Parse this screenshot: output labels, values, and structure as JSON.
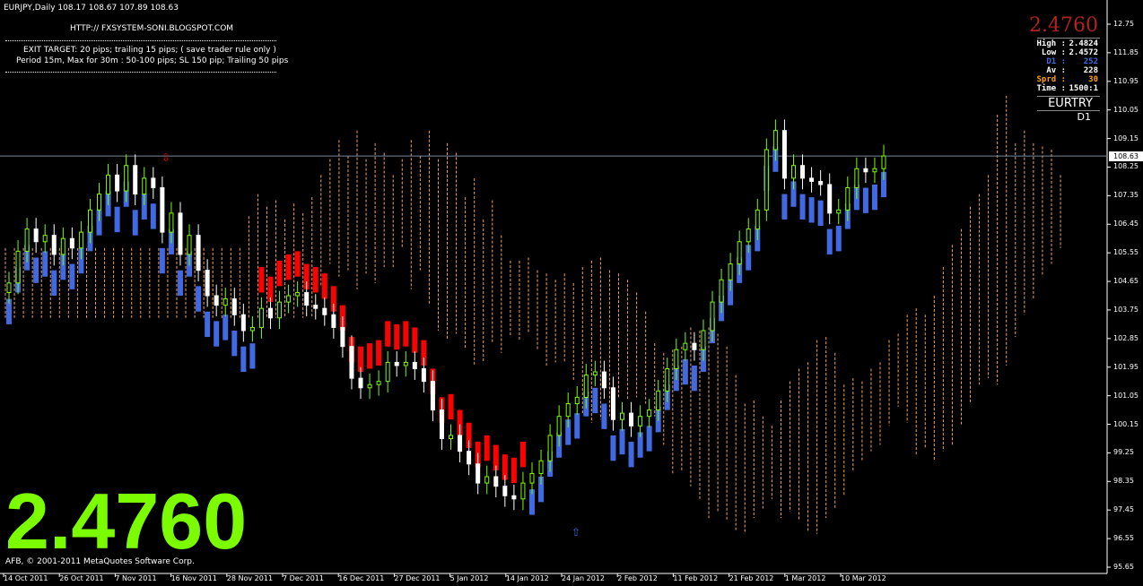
{
  "header": {
    "symbol_info": "EURJPY,Daily  108.17 108.67 107.89 108.63",
    "url": "HTTP:// FXSYSTEM-SONI.BLOGSPOT.COM",
    "exit_line1": "EXIT TARGET: 20 pips; trailing 15 pips; ( save trader rule only )",
    "exit_line2": "Period 15m, Max for 30m   : 50-100 pips; SL 150 pip; Trailing 50 pips"
  },
  "big_price": "2.4760",
  "copyright": "AFB, © 2001-2011 MetaQuotes Software Corp.",
  "info_panel": {
    "price": "2.4760",
    "rows": [
      {
        "label": "High :",
        "value": "2.4824",
        "color": "#ffffff"
      },
      {
        "label": "Low :",
        "value": "2.4572",
        "color": "#ffffff"
      },
      {
        "label": "D1 :",
        "value": "252",
        "color": "#4169e1"
      },
      {
        "label": "Av :",
        "value": "228",
        "color": "#ffffff"
      },
      {
        "label": "Sprd :",
        "value": "30",
        "color": "#ffa500"
      },
      {
        "label": "Time :",
        "value": "1500:1",
        "color": "#ffffff"
      }
    ],
    "pair": "EURTRY",
    "timeframe": "D1"
  },
  "current_price": "108.63",
  "colors": {
    "background": "#000000",
    "bull_candle": "#7cfc00",
    "bear_candle": "#ffffff",
    "up_trend": "#4169e1",
    "down_trend": "#ff0000",
    "cloud": "#f4a460",
    "big_price": "#7cfc00"
  },
  "chart_data": {
    "type": "candlestick",
    "ylim": [
      95.65,
      12.75
    ],
    "y_ticks": [
      "12.75",
      "111.85",
      "110.95",
      "110.05",
      "109.15",
      "108.25",
      "107.35",
      "106.45",
      "105.55",
      "104.65",
      "103.75",
      "102.85",
      "101.95",
      "101.05",
      "100.15",
      "99.25",
      "98.35",
      "97.45",
      "96.55",
      "95.65"
    ],
    "y_tick_values": [
      112.75,
      111.85,
      110.95,
      110.05,
      109.15,
      108.25,
      107.35,
      106.45,
      105.55,
      104.65,
      103.75,
      102.85,
      101.95,
      101.05,
      100.15,
      99.25,
      98.35,
      97.45,
      96.55,
      95.65
    ],
    "x_ticks": [
      "14 Oct 2011",
      "26 Oct 2011",
      "7 Nov 2011",
      "16 Nov 2011",
      "28 Nov 2011",
      "7 Dec 2011",
      "16 Dec 2011",
      "27 Dec 2011",
      "5 Jan 2012",
      "14 Jan 2012",
      "24 Jan 2012",
      "2 Feb 2012",
      "11 Feb 2012",
      "21 Feb 2012",
      "1 Mar 2012",
      "10 Mar 2012"
    ],
    "closes": [
      104.6,
      105.6,
      106.3,
      105.9,
      106.1,
      105.5,
      106.0,
      105.7,
      106.2,
      106.9,
      107.4,
      108.0,
      107.5,
      108.3,
      107.4,
      107.9,
      107.6,
      106.2,
      106.8,
      105.5,
      106.1,
      105.0,
      104.2,
      103.9,
      104.1,
      103.6,
      103.1,
      103.2,
      103.8,
      103.5,
      104.0,
      104.2,
      104.3,
      103.9,
      103.8,
      103.6,
      103.2,
      102.6,
      101.6,
      101.3,
      101.4,
      101.5,
      102.1,
      102.0,
      102.1,
      101.9,
      101.5,
      100.6,
      99.7,
      99.8,
      99.3,
      98.9,
      98.3,
      98.5,
      98.2,
      97.9,
      97.8,
      98.3,
      98.6,
      99.0,
      99.8,
      100.4,
      100.8,
      101.0,
      101.7,
      101.8,
      101.3,
      100.3,
      100.5,
      100.1,
      100.4,
      100.6,
      101.2,
      101.9,
      102.5,
      102.7,
      102.5,
      103.1,
      104.0,
      104.7,
      105.2,
      105.9,
      106.3,
      106.9,
      108.8,
      109.4,
      107.9,
      108.3,
      107.9,
      107.8,
      107.7,
      106.8,
      106.9,
      107.6,
      108.2,
      108.1,
      108.2,
      108.6
    ],
    "series": [
      {
        "name": "Ichimoku Cloud",
        "values": []
      }
    ]
  }
}
